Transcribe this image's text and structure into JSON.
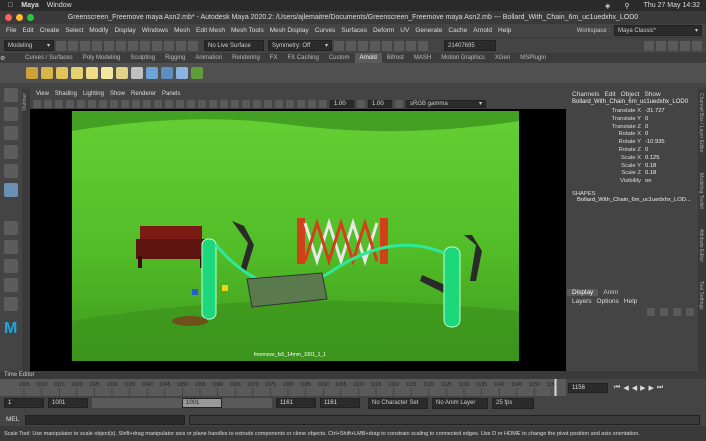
{
  "macbar": {
    "app": "Maya",
    "window_menu": "Window",
    "datetime": "Thu 27 May  14:32"
  },
  "titlebar": {
    "title": "Greenscreen_Freemove maya Asn2.mb* - Autodesk Maya 2020.2: /Users/ajlemaitre/Documents/Greenscreen_Freemove maya Asn2.mb  ---  Bollard_With_Chain_6m_uc1uedxhx_LOD0"
  },
  "menu": [
    "File",
    "Edit",
    "Create",
    "Select",
    "Modify",
    "Display",
    "Windows",
    "Mesh",
    "Edit Mesh",
    "Mesh Tools",
    "Mesh Display",
    "Curves",
    "Surfaces",
    "Deform",
    "UV",
    "Generate",
    "Cache",
    "Arnold",
    "Help"
  ],
  "workspace": {
    "label": "Workspace :",
    "value": "Maya Classic*"
  },
  "status": {
    "mode": "Modeling",
    "live_surface": "No Live Surface",
    "symmetry": "Symmetry: Off",
    "object_id": "21407695"
  },
  "shelf_tabs": [
    "Curves / Surfaces",
    "Poly Modeling",
    "Sculpting",
    "Rigging",
    "Animation",
    "Rendering",
    "FX",
    "FX Caching",
    "Custom",
    "Arnold",
    "Bifrost",
    "MASH",
    "Motion Graphics",
    "XGen",
    "MSPlugin"
  ],
  "shelf_active": "Arnold",
  "panel": {
    "menu": [
      "View",
      "Shading",
      "Lighting",
      "Show",
      "Renderer",
      "Panels"
    ],
    "gamma_value": "1.00",
    "color_space": "sRGB gamma",
    "camera_label": "freemove_fs5_14mm_1001_1_1",
    "outliner": "Outliner"
  },
  "channel_box": {
    "menu": [
      "Channels",
      "Edit",
      "Object",
      "Show"
    ],
    "object": "Bollard_With_Chain_6m_uc1uedxhx_LOD0",
    "attributes": [
      {
        "name": "Translate X",
        "value": "-31.727"
      },
      {
        "name": "Translate Y",
        "value": "0"
      },
      {
        "name": "Translate Z",
        "value": "0"
      },
      {
        "name": "Rotate X",
        "value": "0"
      },
      {
        "name": "Rotate Y",
        "value": "-10.935"
      },
      {
        "name": "Rotate Z",
        "value": "0"
      },
      {
        "name": "Scale X",
        "value": "0.125"
      },
      {
        "name": "Scale Y",
        "value": "0.18"
      },
      {
        "name": "Scale Z",
        "value": "0.18"
      },
      {
        "name": "Visibility",
        "value": "on"
      }
    ],
    "shapes_header": "SHAPES",
    "shape_name": "Bollard_With_Chain_6m_uc1uedxhx_LOD..."
  },
  "side_tabs": [
    "Channel Box / Layer Editor",
    "Modeling Toolkit",
    "Attribute Editor",
    "Tool Settings"
  ],
  "layer_panel": {
    "tabs": [
      "Display",
      "Anim"
    ],
    "active_tab": "Display",
    "menu": [
      "Layers",
      "Options",
      "Help"
    ]
  },
  "time": {
    "editor_label": "Time Editor",
    "ticks": [
      "1005",
      "1010",
      "1015",
      "1020",
      "1025",
      "1030",
      "1035",
      "1040",
      "1045",
      "1050",
      "1055",
      "1060",
      "1065",
      "1070",
      "1075",
      "1080",
      "1085",
      "1090",
      "1095",
      "1100",
      "1105",
      "1110",
      "1115",
      "1120",
      "1125",
      "1130",
      "1135",
      "1140",
      "1145",
      "1150",
      "1155"
    ],
    "current_frame": "1156",
    "range_start": "1",
    "playback_start": "1001",
    "slider_start": "1001",
    "slider_end": "1161",
    "playback_end": "1161",
    "range_end": "1161",
    "character_set": "No Character Set",
    "anim_layer": "No Anim Layer",
    "fps": "25 fps"
  },
  "cmd": {
    "label": "MEL"
  },
  "help": "Scale Tool: Use manipulator to scale object(s). Shift+drag manipulator axis or plane handles to extrude components or clone objects. Ctrl+Shift+LMB+drag to constrain scaling to connected edges. Use D or HOME to change the pivot position and axis orientation."
}
